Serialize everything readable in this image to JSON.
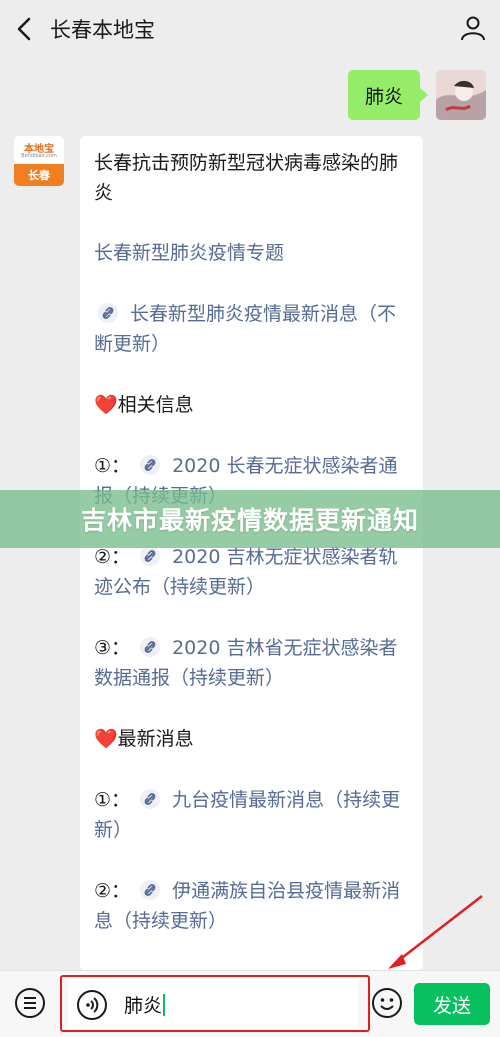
{
  "header": {
    "title": "长春本地宝",
    "back_icon": "chevron-left-icon",
    "profile_icon": "person-icon"
  },
  "chat": {
    "user_message": "肺炎",
    "bot_avatar": {
      "line1": "本地宝",
      "line2": "Bendibao.com",
      "line3": "长春"
    },
    "bot_message": {
      "heading": "长春抗击预防新型冠状病毒感染的肺炎",
      "topic_link": "长春新型肺炎疫情专题",
      "latest_link": "长春新型肺炎疫情最新消息（不断更新）",
      "related_heading": "❤️相关信息",
      "related": [
        {
          "num": "①：",
          "text": "2020 长春无症状感染者通报（持续更新）"
        },
        {
          "num": "②：",
          "text": "2020 吉林无症状感染者轨迹公布（持续更新）"
        },
        {
          "num": "③：",
          "text": "2020 吉林省无症状感染者数据通报（持续更新）"
        }
      ],
      "news_heading": "❤️最新消息",
      "news": [
        {
          "num": "①：",
          "text": "九台疫情最新消息（持续更新）"
        },
        {
          "num": "②：",
          "text": "伊通满族自治县疫情最新消息（持续更新）"
        }
      ]
    }
  },
  "watermark": "吉林市最新疫情数据更新通知",
  "input_bar": {
    "text": "肺炎",
    "send_label": "发送"
  },
  "colors": {
    "send_green": "#07c160",
    "bubble_green": "#95ec69",
    "link_blue": "#576b95",
    "highlight_red": "#e02020"
  }
}
